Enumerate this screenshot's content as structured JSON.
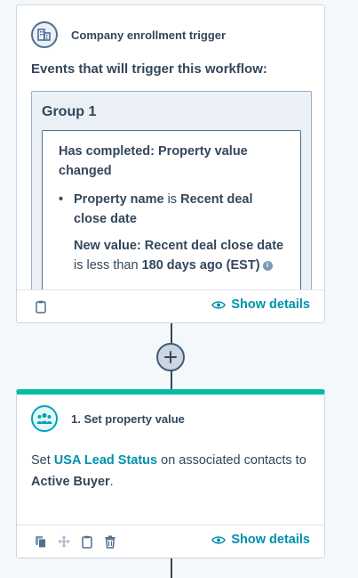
{
  "trigger": {
    "title": "Company enrollment trigger",
    "icon": "company-building-icon",
    "events_label": "Events that will trigger this workflow:",
    "group": {
      "title": "Group 1",
      "filter": {
        "heading": "Has completed: Property value changed",
        "bullet_label": "Property name",
        "bullet_connector": "is",
        "bullet_value": "Recent deal close date",
        "new_value_label": "New value: Recent deal close date",
        "operator": "is less than",
        "value": "180 days ago (EST)"
      }
    },
    "show_details": "Show details"
  },
  "action": {
    "title": "1. Set property value",
    "icon": "contacts-group-icon",
    "body_prefix": "Set",
    "property_link": "USA Lead Status",
    "body_middle": "on associated contacts to",
    "target_value": "Active Buyer",
    "body_suffix": ".",
    "show_details": "Show details"
  },
  "colors": {
    "accent_teal": "#00bda5",
    "link": "#0091ae",
    "text": "#33475b",
    "background": "#f5f8fa"
  }
}
